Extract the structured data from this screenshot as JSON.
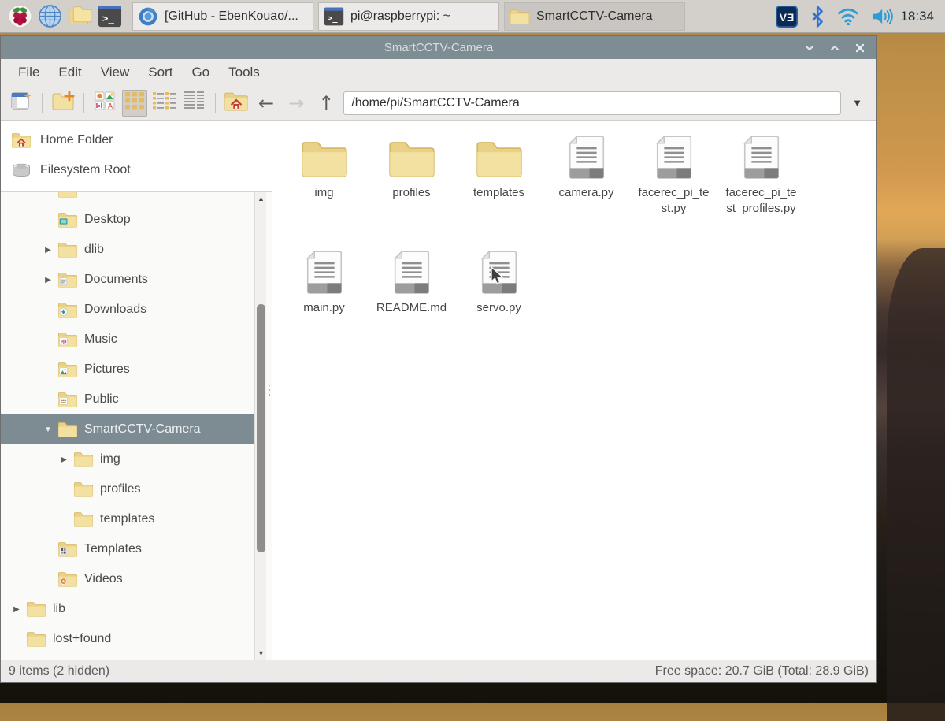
{
  "taskbar": {
    "launchers": [
      {
        "name": "menu-launcher",
        "icon": "raspberry-icon"
      },
      {
        "name": "browser-launcher",
        "icon": "globe-icon"
      },
      {
        "name": "file-manager-launcher",
        "icon": "folders-icon"
      },
      {
        "name": "terminal-launcher",
        "icon": "terminal-icon"
      }
    ],
    "tasks": [
      {
        "icon": "chromium-icon",
        "label": "[GitHub - EbenKouao/...",
        "active": false
      },
      {
        "icon": "terminal-icon",
        "label": "pi@raspberrypi: ~",
        "active": false
      },
      {
        "icon": "folder-icon",
        "label": "SmartCCTV-Camera",
        "active": true
      }
    ],
    "tray": [
      {
        "name": "vnc-indicator",
        "icon": "vnc-icon"
      },
      {
        "name": "bluetooth-indicator",
        "icon": "bluetooth-icon"
      },
      {
        "name": "wifi-indicator",
        "icon": "wifi-icon"
      },
      {
        "name": "volume-indicator",
        "icon": "volume-icon"
      }
    ],
    "clock": "18:34"
  },
  "window": {
    "title": "SmartCCTV-Camera",
    "menu": [
      "File",
      "Edit",
      "View",
      "Sort",
      "Go",
      "Tools"
    ],
    "toolbar": {
      "path": "/home/pi/SmartCCTV-Camera"
    },
    "places": [
      {
        "label": "Home Folder",
        "icon": "home-folder-icon"
      },
      {
        "label": "Filesystem Root",
        "icon": "disk-icon"
      }
    ],
    "tree": [
      {
        "label": "",
        "indent": 2,
        "expander": "none",
        "emblem": "none"
      },
      {
        "label": "Desktop",
        "indent": 2,
        "expander": "none",
        "emblem": "desktop"
      },
      {
        "label": "dlib",
        "indent": 2,
        "expander": "collapsed",
        "emblem": "none"
      },
      {
        "label": "Documents",
        "indent": 2,
        "expander": "collapsed",
        "emblem": "documents"
      },
      {
        "label": "Downloads",
        "indent": 2,
        "expander": "none",
        "emblem": "downloads"
      },
      {
        "label": "Music",
        "indent": 2,
        "expander": "none",
        "emblem": "music"
      },
      {
        "label": "Pictures",
        "indent": 2,
        "expander": "none",
        "emblem": "pictures"
      },
      {
        "label": "Public",
        "indent": 2,
        "expander": "none",
        "emblem": "public"
      },
      {
        "label": "SmartCCTV-Camera",
        "indent": 2,
        "expander": "expanded",
        "emblem": "none",
        "selected": true
      },
      {
        "label": "img",
        "indent": 3,
        "expander": "collapsed",
        "emblem": "none"
      },
      {
        "label": "profiles",
        "indent": 3,
        "expander": "none",
        "emblem": "none"
      },
      {
        "label": "templates",
        "indent": 3,
        "expander": "none",
        "emblem": "none"
      },
      {
        "label": "Templates",
        "indent": 2,
        "expander": "none",
        "emblem": "templates"
      },
      {
        "label": "Videos",
        "indent": 2,
        "expander": "none",
        "emblem": "videos"
      },
      {
        "label": "lib",
        "indent": 1,
        "expander": "collapsed",
        "emblem": "none"
      },
      {
        "label": "lost+found",
        "indent": 1,
        "expander": "none",
        "emblem": "none"
      },
      {
        "label": "",
        "indent": 1,
        "expander": "none",
        "emblem": "none"
      }
    ],
    "files": [
      {
        "name": "img",
        "type": "folder"
      },
      {
        "name": "profiles",
        "type": "folder"
      },
      {
        "name": "templates",
        "type": "folder"
      },
      {
        "name": "camera.py",
        "type": "file"
      },
      {
        "name": "facerec_pi_test.py",
        "type": "file"
      },
      {
        "name": "facerec_pi_test_profiles.py",
        "type": "file"
      },
      {
        "name": "main.py",
        "type": "file"
      },
      {
        "name": "README.md",
        "type": "file"
      },
      {
        "name": "servo.py",
        "type": "file"
      }
    ],
    "statusbar": {
      "left": "9 items (2 hidden)",
      "right": "Free space: 20.7 GiB (Total: 28.9 GiB)"
    }
  },
  "colors": {
    "titlebar": "#7e8d93",
    "selection": "#7d8c92",
    "folder": "#f1dc9b",
    "accent_blue": "#2f9bd6"
  }
}
